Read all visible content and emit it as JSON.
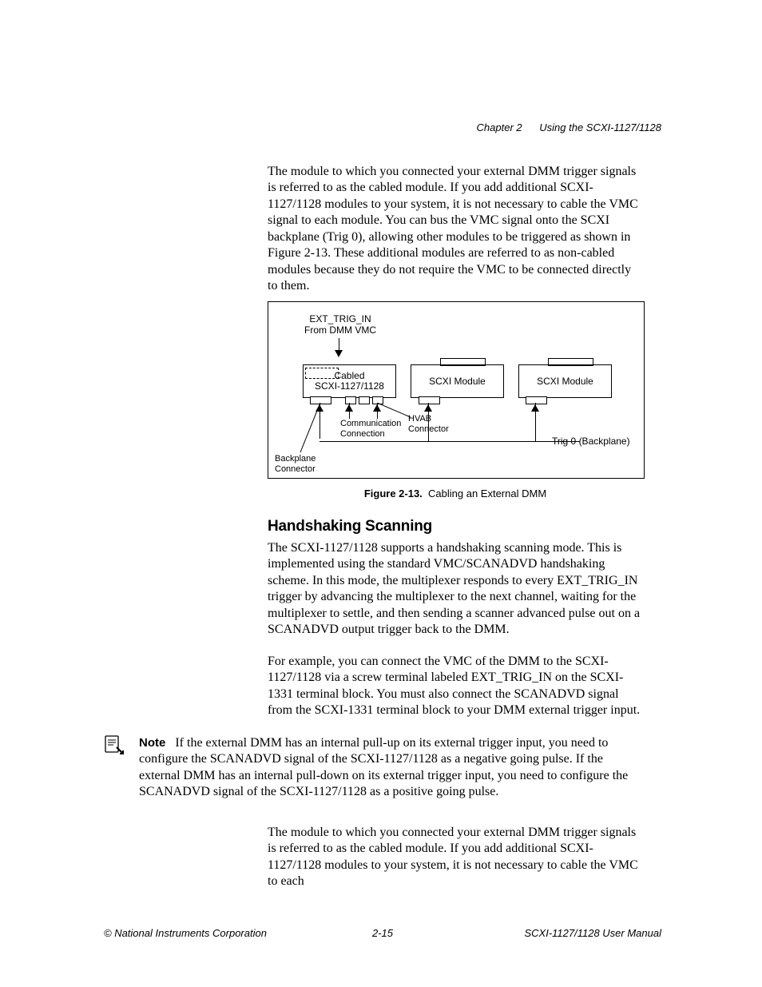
{
  "header": {
    "chapter": "Chapter 2",
    "title": "Using the SCXI-1127/1128"
  },
  "para1": "The module to which you connected your external DMM trigger signals is referred to as the cabled module. If you add additional SCXI-1127/1128 modules to your system, it is not necessary to cable the VMC signal to each module. You can bus the VMC signal onto the SCXI backplane (Trig 0), allowing other modules to be triggered as shown in Figure 2-13. These additional modules are referred to as non-cabled modules because they do not require the VMC to be connected directly to them.",
  "figure": {
    "ext_trig_label_line1": "EXT_TRIG_IN",
    "ext_trig_label_line2": "From DMM VMC",
    "cabled_line1": "Cabled",
    "cabled_line2": "SCXI-1127/1128",
    "module_label": "SCXI Module",
    "comm_conn_line1": "Communication",
    "comm_conn_line2": "Connection",
    "hvab_line1": "HVAB",
    "hvab_line2": "Connector",
    "backplane_line1": "Backplane",
    "backplane_line2": "Connector",
    "trig0": "Trig 0 (Backplane)"
  },
  "fig_caption": {
    "number": "Figure 2-13.",
    "text": "Cabling an External DMM"
  },
  "h2": "Handshaking Scanning",
  "para2": "The SCXI-1127/1128 supports a handshaking scanning mode. This is implemented using the standard VMC/SCANADVD handshaking scheme. In this mode, the multiplexer responds to every EXT_TRIG_IN trigger by advancing the multiplexer to the next channel, waiting for the multiplexer to settle, and then sending a scanner advanced pulse out on a SCANADVD output trigger back to the DMM.",
  "para3": "For example, you can connect the VMC of the DMM to the SCXI-1127/1128 via a screw terminal labeled EXT_TRIG_IN on the SCXI-1331 terminal block. You must also connect the SCANADVD signal from the SCXI-1331 terminal block to your DMM external trigger input.",
  "note": {
    "label": "Note",
    "text": "If the external DMM has an internal pull-up on its external trigger input, you need to configure the SCANADVD signal of the SCXI-1127/1128 as a negative going pulse. If the external DMM has an internal pull-down on its external trigger input, you need to configure the SCANADVD signal of the SCXI-1127/1128 as a positive going pulse."
  },
  "para4": "The module to which you connected your external DMM trigger signals is referred to as the cabled module. If you add additional SCXI-1127/1128 modules to your system, it is not necessary to cable the VMC to each",
  "footer": {
    "left": "© National Instruments Corporation",
    "center": "2-15",
    "right": "SCXI-1127/1128 User Manual"
  }
}
